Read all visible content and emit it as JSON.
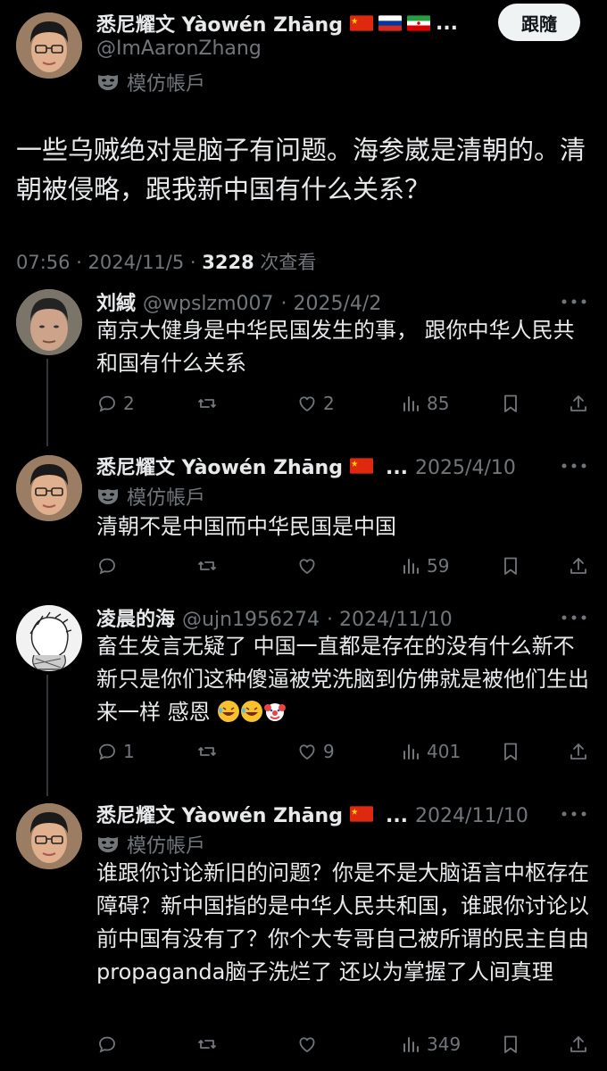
{
  "main_post": {
    "author_name": "悉尼耀文 Yàowén Zhāng",
    "author_flags_more": "...",
    "handle": "@ImAaronZhang",
    "parody_label": "模仿帳戶",
    "follow_label": "跟隨",
    "text": "一些乌贼绝对是脑子有问题。海参崴是清朝的。清朝被侵略，跟我新中国有什么关系？",
    "time": "07:56 · 2024/11/5 · ",
    "views": "3228",
    "views_label": " 次查看"
  },
  "replies": [
    {
      "name": "刘緎",
      "handle": "@wpslzm007",
      "date": "· 2025/4/2",
      "text": "南京大健身是中华民国发生的事， 跟你中华人民共和国有什么关系",
      "replies": "2",
      "likes": "2",
      "views": "85"
    },
    {
      "name": "悉尼耀文 Yàowén Zhāng",
      "flags_more": "...",
      "date": "2025/4/10",
      "parody_label": "模仿帳戶",
      "text": "清朝不是中国而中华民国是中国",
      "views": "59"
    },
    {
      "name": "凌晨的海",
      "handle": "@ujn1956274",
      "date": "· 2024/11/10",
      "text": "畜生发言无疑了 中国一直都是存在的没有什么新不新只是你们这种傻逼被党洗脑到仿佛就是被他们生出来一样 感恩",
      "replies": "1",
      "likes": "9",
      "views": "401"
    },
    {
      "name": "悉尼耀文 Yàowén Zhāng",
      "flags_more": "...",
      "date": "2024/11/10",
      "parody_label": "模仿帳戶",
      "text": "谁跟你讨论新旧的问题？你是不是大脑语言中枢存在障碍？新中国指的是中华人民共和国，谁跟你讨论以前中国有没有了？你个大专哥自己被所谓的民主自由propaganda脑子洗烂了 还以为掌握了人间真理",
      "views": "349"
    }
  ],
  "icons": [
    "reply-icon",
    "retweet-icon",
    "like-icon",
    "views-icon",
    "bookmark-icon",
    "share-icon",
    "more-icon",
    "parody-mask-icon"
  ],
  "colors": {
    "background": "#000000",
    "text": "#e7e9ea",
    "muted": "#71767b",
    "button_bg": "#eff3f4"
  }
}
